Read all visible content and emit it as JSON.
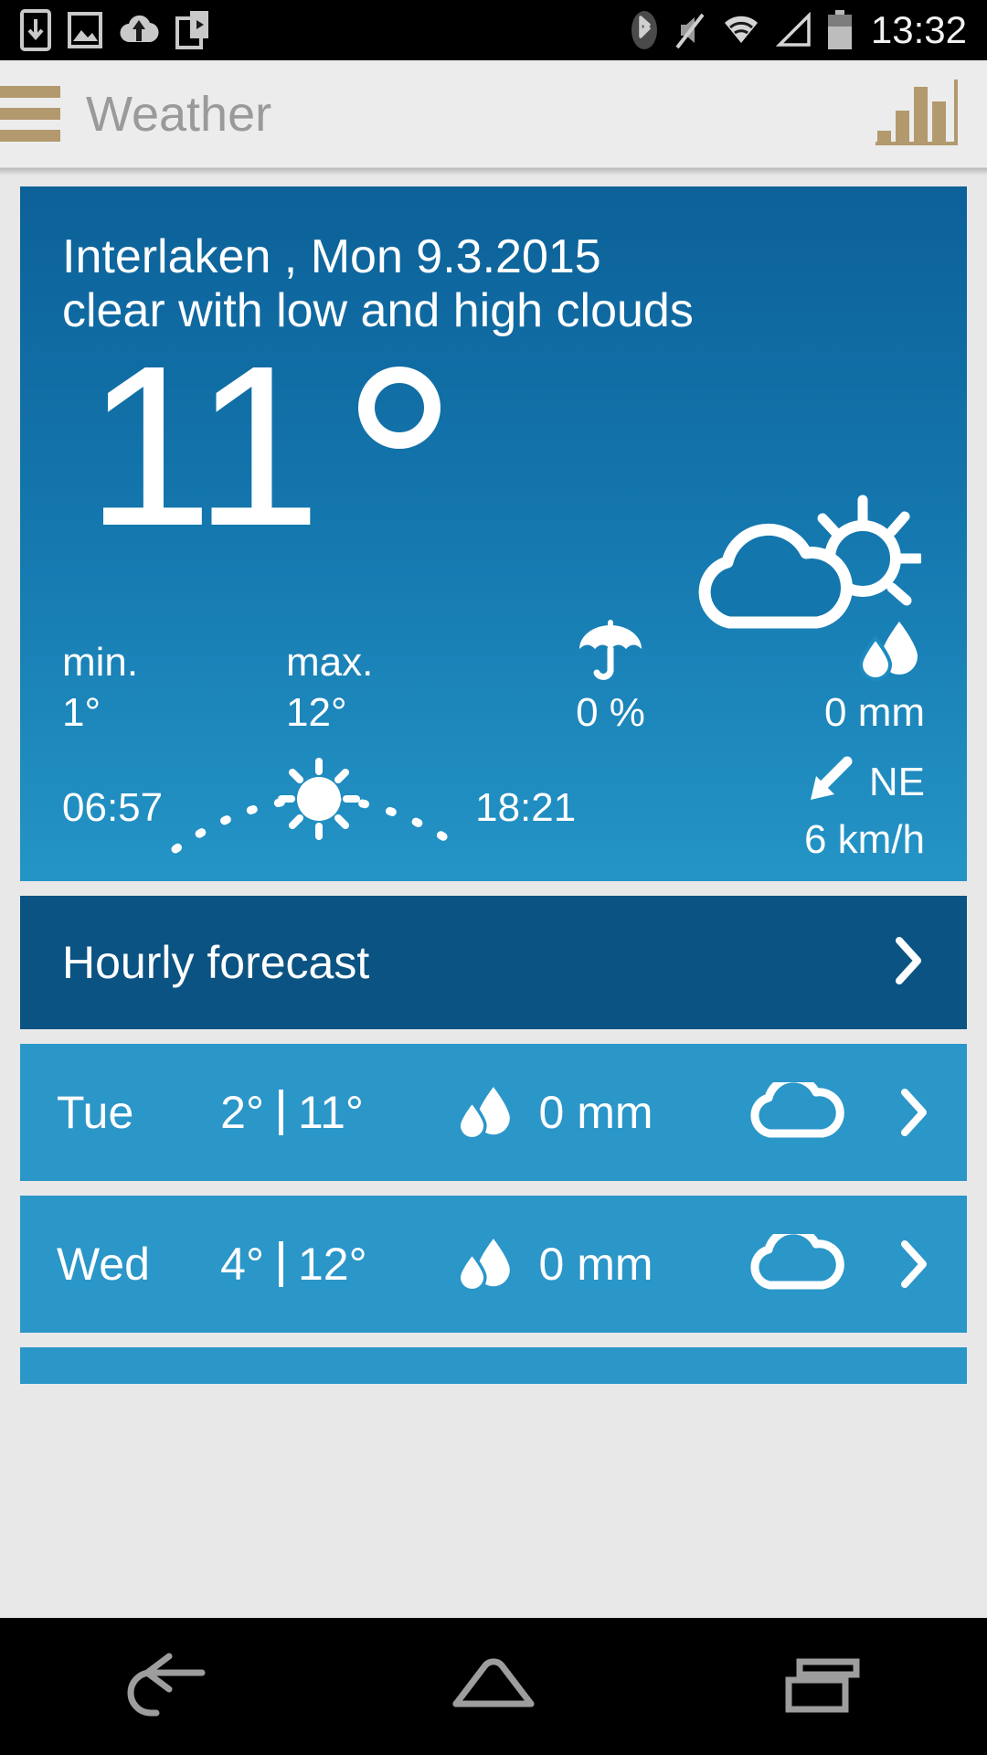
{
  "statusbar": {
    "time": "13:32",
    "left_icons": [
      "download-icon",
      "image-icon",
      "cloud-upload-icon",
      "video-clip-icon"
    ],
    "right_icons": [
      "bluetooth-icon",
      "mute-icon",
      "wifi-icon",
      "signal-icon",
      "battery-icon"
    ]
  },
  "appbar": {
    "menu_icon": "hamburger-menu-icon",
    "title": "Weather",
    "action_icon": "bar-chart-icon",
    "accent_color": "#b29a6e",
    "title_color": "#9a9a9a"
  },
  "current": {
    "location_date": "Interlaken , Mon 9.3.2015",
    "condition": "clear with low and high clouds",
    "temperature": "11",
    "degree_symbol": "°",
    "weather_icon": "sun-behind-cloud-icon",
    "min_label": "min.",
    "min_value": "1°",
    "max_label": "max.",
    "max_value": "12°",
    "rain_prob_icon": "umbrella-icon",
    "rain_prob": "0 %",
    "rain_amount_icon": "raindrops-icon",
    "rain_amount": "0 mm",
    "sunrise": "06:57",
    "sunset": "18:21",
    "sun_arc_icon": "sun-icon",
    "wind_arrow_icon": "wind-arrow-southwest-icon",
    "wind_direction": "NE",
    "wind_speed": "6 km/h",
    "card_gradient_top": "#0c6198",
    "card_gradient_bottom": "#2494c6"
  },
  "hourly": {
    "label": "Hourly forecast",
    "chevron_icon": "chevron-right-icon",
    "background": "#0b5382"
  },
  "forecast": {
    "days": [
      {
        "day": "Tue",
        "temp_min": "2°",
        "temp_max": "11°",
        "drop_icon": "raindrops-icon",
        "rain": "0 mm",
        "condition_icon": "cloud-icon",
        "chevron_icon": "chevron-right-icon"
      },
      {
        "day": "Wed",
        "temp_min": "4°",
        "temp_max": "12°",
        "drop_icon": "raindrops-icon",
        "rain": "0 mm",
        "condition_icon": "cloud-icon",
        "chevron_icon": "chevron-right-icon"
      }
    ],
    "row_background": "#2b96c8"
  },
  "navbar": {
    "back_icon": "back-arrow-icon",
    "home_icon": "home-icon",
    "recents_icon": "recent-apps-icon"
  }
}
